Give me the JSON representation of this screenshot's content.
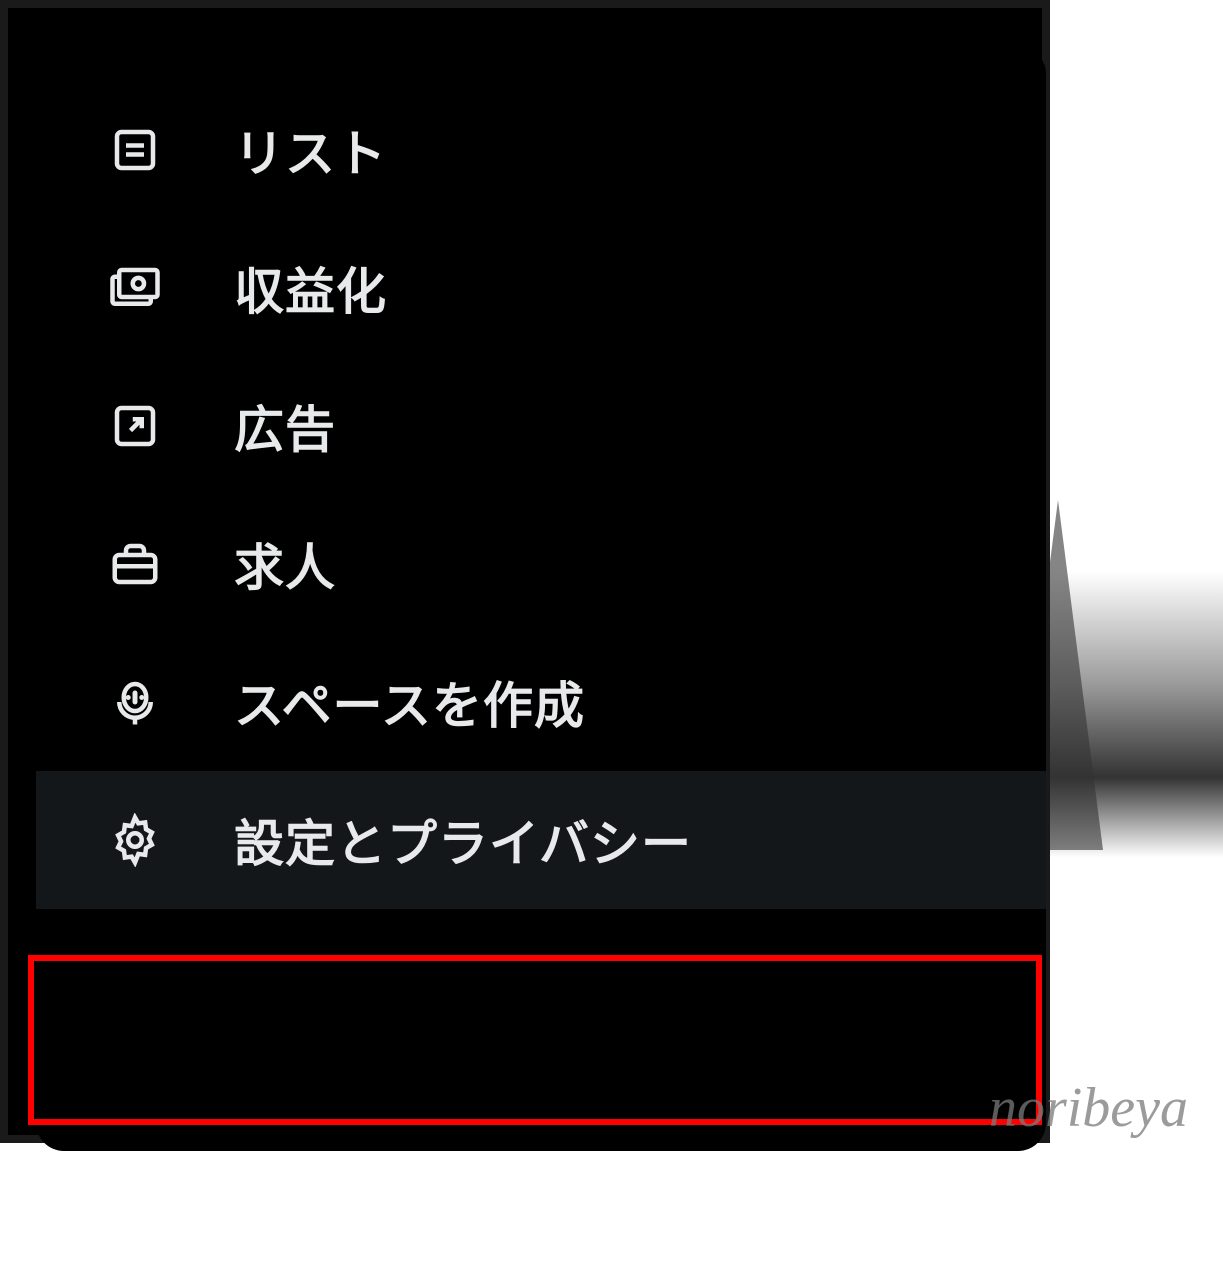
{
  "menu": {
    "items": [
      {
        "id": "lists",
        "label": "リスト",
        "icon": "list-icon"
      },
      {
        "id": "monetization",
        "label": "収益化",
        "icon": "monetization-icon"
      },
      {
        "id": "ads",
        "label": "広告",
        "icon": "external-link-icon"
      },
      {
        "id": "jobs",
        "label": "求人",
        "icon": "briefcase-icon"
      },
      {
        "id": "create-space",
        "label": "スペースを作成",
        "icon": "microphone-icon"
      },
      {
        "id": "settings",
        "label": "設定とプライバシー",
        "icon": "gear-icon",
        "highlighted": true
      }
    ]
  },
  "watermark": "noribeya",
  "colors": {
    "background": "#000000",
    "text": "#e7e9ea",
    "highlight_bg": "#14171a",
    "annotation_border": "#ff0000"
  }
}
